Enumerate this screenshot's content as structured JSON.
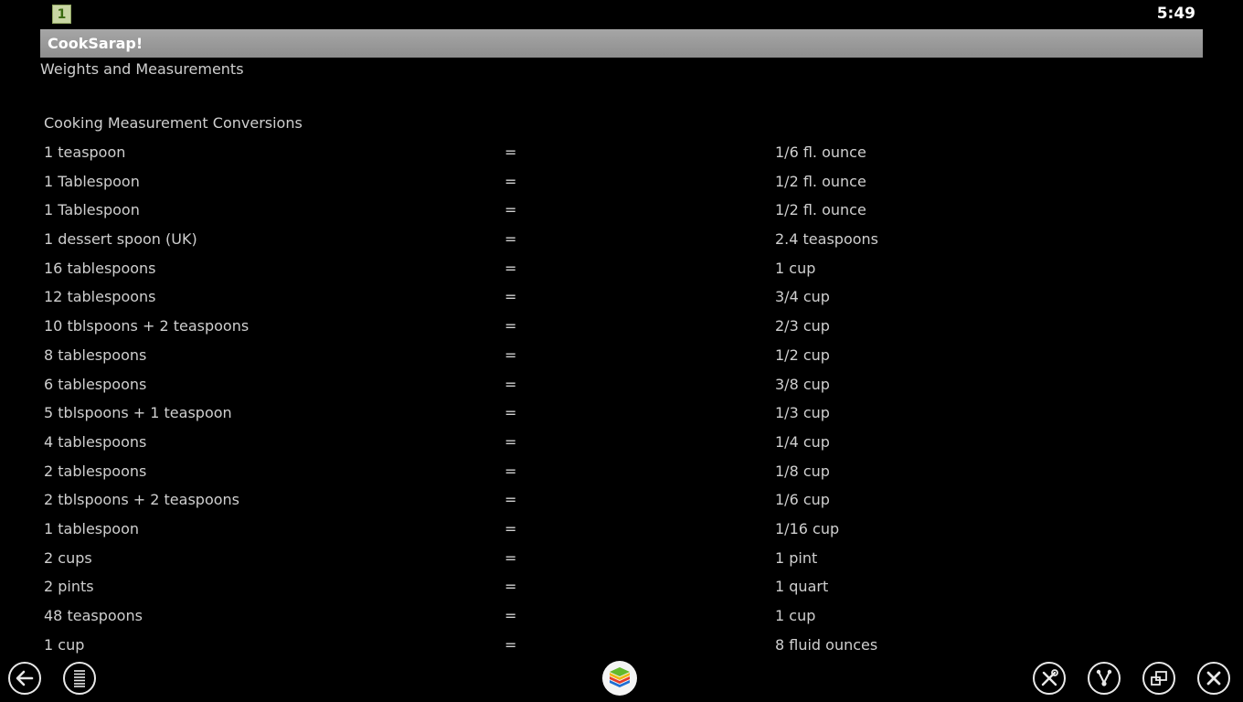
{
  "status_bar": {
    "notification_icon": "1",
    "time": "5:49"
  },
  "app": {
    "title": "CookSarap!",
    "page_heading": "Weights and Measurements",
    "section_heading": "Cooking Measurement Conversions"
  },
  "conversions": [
    {
      "from": "1 teaspoon",
      "eq": "=",
      "to": "1/6 fl. ounce"
    },
    {
      "from": "1 Tablespoon",
      "eq": "=",
      "to": "1/2 fl. ounce"
    },
    {
      "from": "1 Tablespoon",
      "eq": "=",
      "to": "1/2 fl. ounce"
    },
    {
      "from": "1 dessert spoon (UK)",
      "eq": "=",
      "to": "2.4 teaspoons"
    },
    {
      "from": "16 tablespoons",
      "eq": "=",
      "to": "1 cup"
    },
    {
      "from": "12 tablespoons",
      "eq": "=",
      "to": "3/4 cup"
    },
    {
      "from": "10 tblspoons + 2 teaspoons",
      "eq": "=",
      "to": "2/3 cup"
    },
    {
      "from": "8 tablespoons",
      "eq": "=",
      "to": "1/2 cup"
    },
    {
      "from": "6 tablespoons",
      "eq": "=",
      "to": "3/8 cup"
    },
    {
      "from": "5 tblspoons + 1 teaspoon",
      "eq": "=",
      "to": "1/3 cup"
    },
    {
      "from": "4 tablespoons",
      "eq": "=",
      "to": "1/4 cup"
    },
    {
      "from": "2 tablespoons",
      "eq": "=",
      "to": "1/8 cup"
    },
    {
      "from": "2 tblspoons + 2 teaspoons",
      "eq": "=",
      "to": "1/6 cup"
    },
    {
      "from": "1 tablespoon",
      "eq": "=",
      "to": "1/16 cup"
    },
    {
      "from": "2 cups",
      "eq": "=",
      "to": "1 pint"
    },
    {
      "from": "2 pints",
      "eq": "=",
      "to": "1 quart"
    },
    {
      "from": "48 teaspoons",
      "eq": "=",
      "to": "1 cup"
    },
    {
      "from": "1 cup",
      "eq": "=",
      "to": "8 fluid ounces"
    }
  ],
  "nav_bar": {
    "icons": [
      "back-icon",
      "menu-icon",
      "bluestacks-home-icon",
      "settings-tools-icon",
      "share-icon",
      "resize-window-icon",
      "close-icon"
    ]
  }
}
